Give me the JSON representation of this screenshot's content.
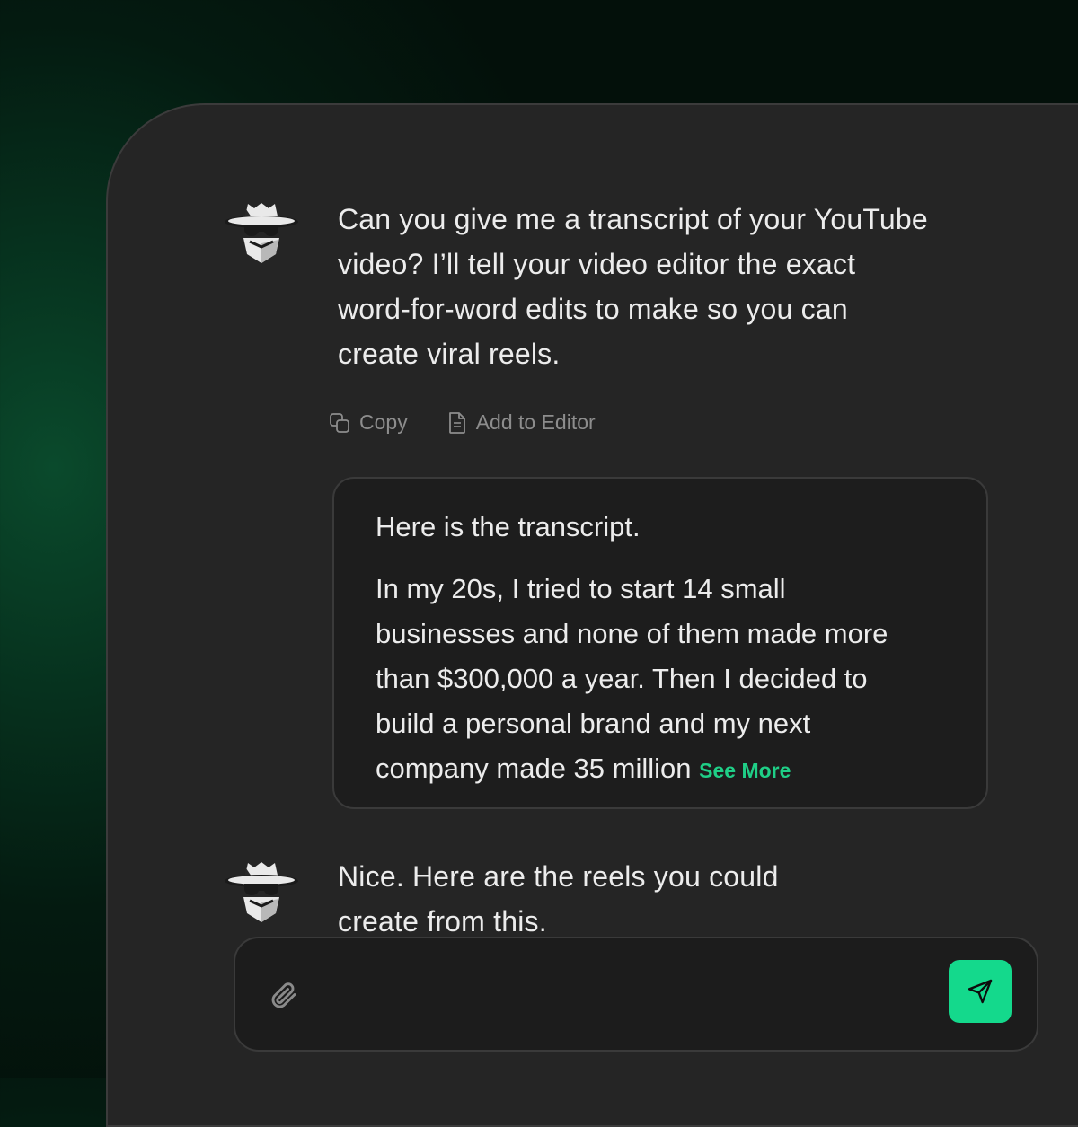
{
  "chat": {
    "messages": [
      {
        "sender_icon": "spy-agent-icon",
        "text_lines": [
          "Can you give me a transcript of your YouTube",
          "video? I’ll tell your video editor the exact",
          "word-for-word edits to make so you can",
          "create viral reels."
        ]
      },
      {
        "sender_icon": "spy-agent-icon",
        "text_lines": [
          "Nice. Here are the reels you could",
          "create from this."
        ]
      }
    ],
    "actions": {
      "copy_label": "Copy",
      "copy_icon": "copy-icon",
      "add_editor_label": "Add to Editor",
      "add_editor_icon": "document-icon"
    },
    "transcript": {
      "intro": "Here is the transcript.",
      "lines": [
        "In my 20s, I tried to start 14 small",
        "businesses and none of them made more",
        "than $300,000 a year. Then I decided to",
        "build a personal brand and my next",
        "company made 35 million"
      ],
      "see_more": "See More"
    },
    "composer": {
      "attach_icon": "paperclip-icon",
      "send_icon": "send-icon"
    }
  },
  "colors": {
    "accent": "#14d98c",
    "see_more": "#1fcf87",
    "panel": "#252525",
    "card": "#1d1d1d"
  }
}
